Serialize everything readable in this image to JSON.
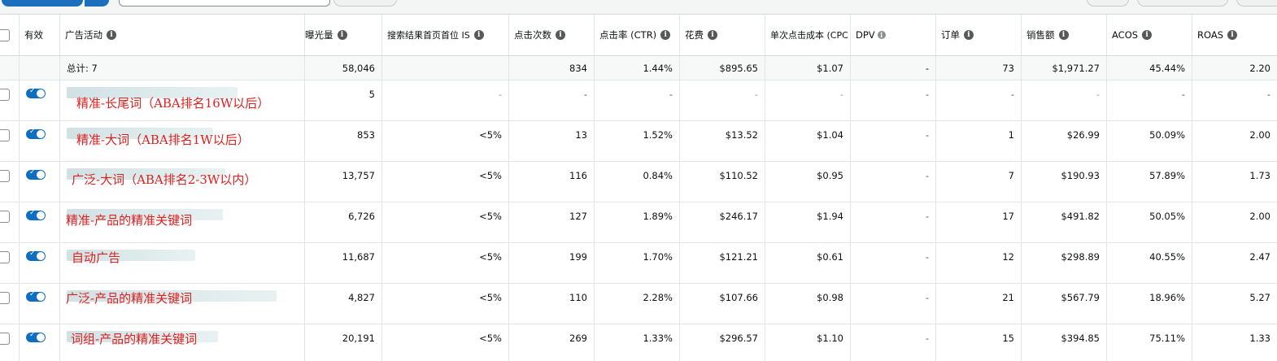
{
  "headers": {
    "effective": "有效",
    "campaign": "广告活动",
    "impressions": "曝光量",
    "top_is": "搜索结果首页首位 IS",
    "clicks": "点击次数",
    "ctr": "点击率 (CTR)",
    "spend": "花费",
    "cpc": "单次点击成本 (CPC",
    "dpv": "DPV",
    "orders": "订单",
    "sales": "销售额",
    "acos": "ACOS",
    "roas": "ROAS"
  },
  "totals": {
    "label": "总计: 7",
    "impressions": "58,046",
    "clicks": "834",
    "ctr": "1.44%",
    "spend": "$895.65",
    "cpc": "$1.07",
    "dpv": "-",
    "orders": "73",
    "sales": "$1,971.27",
    "acos": "45.44%",
    "roas": "2.20"
  },
  "rows": [
    {
      "name": "精准-长尾词（ABA排名16W以后）",
      "impressions": "5",
      "top_is": "-",
      "clicks": "-",
      "ctr": "-",
      "spend": "-",
      "cpc": "-",
      "dpv": "-",
      "orders": "-",
      "sales": "-",
      "acos": "-",
      "roas": "-"
    },
    {
      "name": "精准-大词（ABA排名1W以后）",
      "impressions": "853",
      "top_is": "<5%",
      "clicks": "13",
      "ctr": "1.52%",
      "spend": "$13.52",
      "cpc": "$1.04",
      "dpv": "-",
      "orders": "1",
      "sales": "$26.99",
      "acos": "50.09%",
      "roas": "2.00"
    },
    {
      "name": "广泛-大词（ABA排名2-3W以内）",
      "impressions": "13,757",
      "top_is": "<5%",
      "clicks": "116",
      "ctr": "0.84%",
      "spend": "$110.52",
      "cpc": "$0.95",
      "dpv": "-",
      "orders": "7",
      "sales": "$190.93",
      "acos": "57.89%",
      "roas": "1.73"
    },
    {
      "name": "精准-产品的精准关键词",
      "impressions": "6,726",
      "top_is": "<5%",
      "clicks": "127",
      "ctr": "1.89%",
      "spend": "$246.17",
      "cpc": "$1.94",
      "dpv": "-",
      "orders": "17",
      "sales": "$491.82",
      "acos": "50.05%",
      "roas": "2.00"
    },
    {
      "name": "自动广告",
      "impressions": "11,687",
      "top_is": "<5%",
      "clicks": "199",
      "ctr": "1.70%",
      "spend": "$121.21",
      "cpc": "$0.61",
      "dpv": "-",
      "orders": "12",
      "sales": "$298.89",
      "acos": "40.55%",
      "roas": "2.47"
    },
    {
      "name": "广泛-产品的精准关键词",
      "impressions": "4,827",
      "top_is": "<5%",
      "clicks": "110",
      "ctr": "2.28%",
      "spend": "$107.66",
      "cpc": "$0.98",
      "dpv": "-",
      "orders": "21",
      "sales": "$567.79",
      "acos": "18.96%",
      "roas": "5.27"
    },
    {
      "name": "词组-产品的精准关键词",
      "impressions": "20,191",
      "top_is": "<5%",
      "clicks": "269",
      "ctr": "1.33%",
      "spend": "$296.57",
      "cpc": "$1.10",
      "dpv": "-",
      "orders": "15",
      "sales": "$394.85",
      "acos": "75.11%",
      "roas": "1.33"
    }
  ],
  "colors": {
    "toggle_on": "#0e6fc0",
    "annotation_red": "#e0201f"
  },
  "icons": {
    "info": "info-circle-icon",
    "toggle": "toggle-switch-icon"
  }
}
